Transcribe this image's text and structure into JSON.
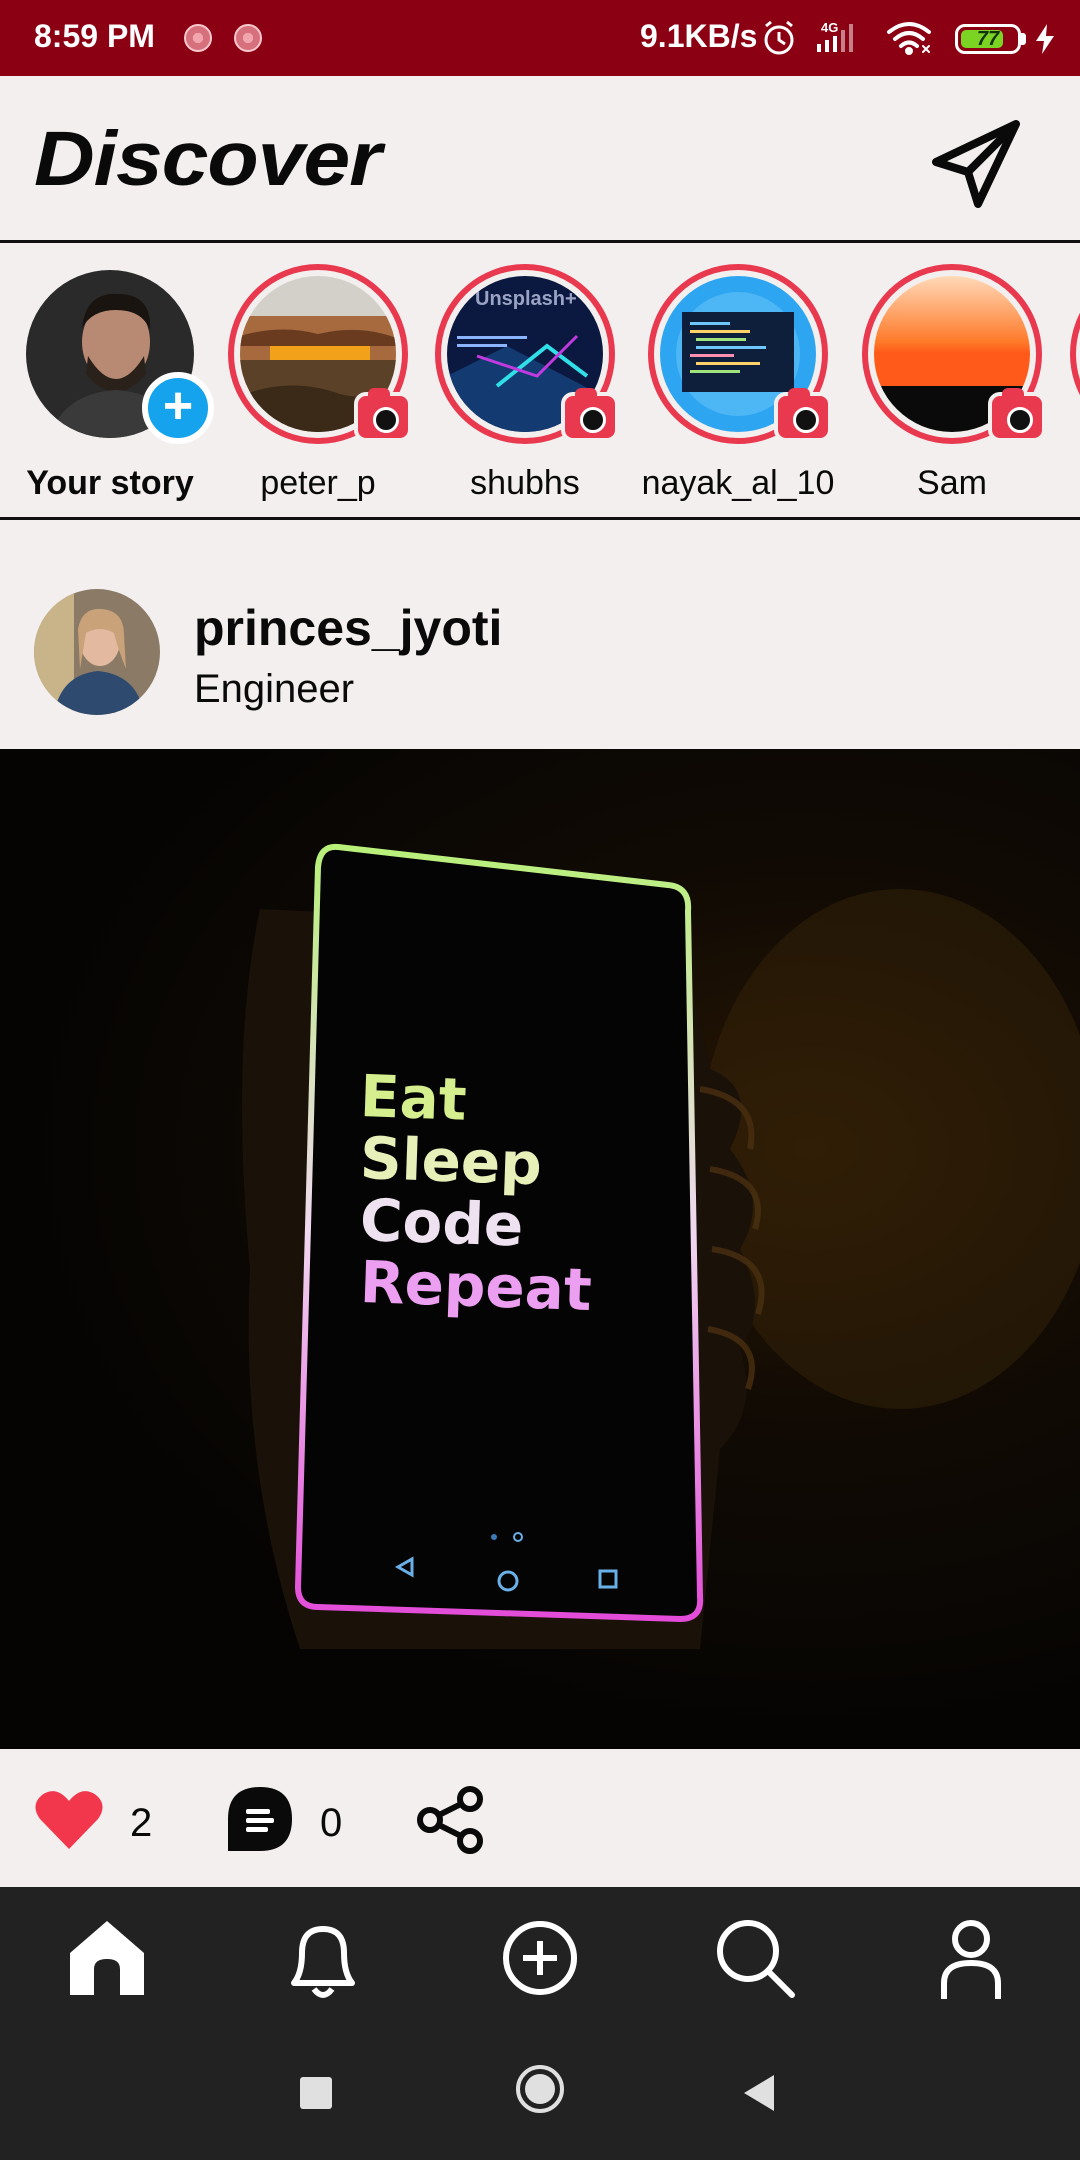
{
  "status_bar": {
    "time": "8:59 PM",
    "network_speed": "9.1KB/s",
    "signal_label": "4G",
    "battery_level": "77",
    "battery_percent": 77,
    "icons": [
      "alarm-icon",
      "signal-icon",
      "wifi-icon",
      "battery-icon",
      "charging-icon"
    ]
  },
  "header": {
    "title": "Discover",
    "send_icon": "paper-plane-icon"
  },
  "stories": [
    {
      "name": "Your story",
      "is_self": true
    },
    {
      "name": "peter_p"
    },
    {
      "name": "shubhs"
    },
    {
      "name": "nayak_al_10"
    },
    {
      "name": "Sam"
    }
  ],
  "story_image_text": {
    "shubhs_watermark": "Unsplash+"
  },
  "post": {
    "username": "princes_jyoti",
    "subtitle": "Engineer",
    "image_text": [
      "Eat",
      "Sleep",
      "Code",
      "Repeat"
    ],
    "likes": "2",
    "comments": "0"
  },
  "bottom_nav": {
    "items": [
      "home-icon",
      "bell-icon",
      "add-circle-icon",
      "search-icon",
      "profile-icon"
    ]
  },
  "system_nav": {
    "items": [
      "recents-icon",
      "home-circle-icon",
      "back-icon"
    ]
  },
  "colors": {
    "status_bar": "#8b0013",
    "story_ring": "#e8394f",
    "add_badge": "#14a3ec",
    "nav_bg": "#222222",
    "page_bg": "#f3efee"
  }
}
